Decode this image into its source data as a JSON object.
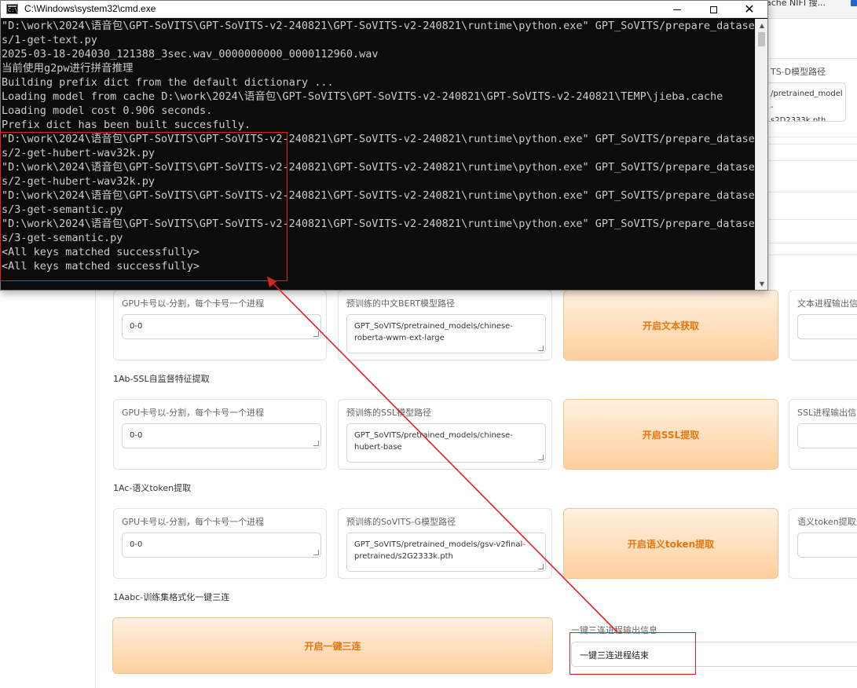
{
  "browser": {
    "tab_text": "ache NIFI 搜..."
  },
  "top_right_panel": {
    "label": "TS-D模型路径",
    "value": "/pretrained_model\n-\ns2D2333k.pth"
  },
  "sections": {
    "ssl_title": "1Ab-SSL自监督特征提取",
    "token_title": "1Ac-语义token提取",
    "abc_title": "1Aabc-训练集格式化一键三连"
  },
  "text_row": {
    "gpu_label": "GPU卡号以-分割，每个卡号一个进程",
    "gpu_value": "0-0",
    "model_label": "预训练的中文BERT模型路径",
    "model_value": "GPT_SoVITS/pretrained_models/chinese-roberta-wwm-ext-large",
    "button": "开启文本获取",
    "out_label": "文本进程输出信"
  },
  "ssl_row": {
    "gpu_label": "GPU卡号以-分割，每个卡号一个进程",
    "gpu_value": "0-0",
    "model_label": "预训练的SSL模型路径",
    "model_value": "GPT_SoVITS/pretrained_models/chinese-hubert-base",
    "button": "开启SSL提取",
    "out_label": "SSL进程输出信息"
  },
  "token_row": {
    "gpu_label": "GPU卡号以-分割，每个卡号一个进程",
    "gpu_value": "0-0",
    "model_label": "预训练的SoVITS-G模型路径",
    "model_value": "GPT_SoVITS/pretrained_models/gsv-v2final-pretrained/s2G2333k.pth",
    "button": "开启语义token提取",
    "out_label": "语义token提取进"
  },
  "abc_row": {
    "button": "开启一键三连",
    "out_label": "一键三连进程输出信息",
    "out_value": "一键三连进程结束"
  },
  "cmd": {
    "title": "C:\\Windows\\system32\\cmd.exe",
    "icon_text": "C:\\",
    "lines": [
      "\"D:\\work\\2024\\语音包\\GPT-SoVITS\\GPT-SoVITS-v2-240821\\GPT-SoVITS-v2-240821\\runtime\\python.exe\" GPT_SoVITS/prepare_dataset",
      "s/1-get-text.py",
      "2025-03-18-204030_121388_3sec.wav_0000000000_0000112960.wav",
      "当前使用g2pw进行拼音推理",
      "Building prefix dict from the default dictionary ...",
      "Loading model from cache D:\\work\\2024\\语音包\\GPT-SoVITS\\GPT-SoVITS-v2-240821\\GPT-SoVITS-v2-240821\\TEMP\\jieba.cache",
      "Loading model cost 0.906 seconds.",
      "Prefix dict has been built succesfully.",
      "\"D:\\work\\2024\\语音包\\GPT-SoVITS\\GPT-SoVITS-v2-240821\\GPT-SoVITS-v2-240821\\runtime\\python.exe\" GPT_SoVITS/prepare_dataset",
      "s/2-get-hubert-wav32k.py",
      "\"D:\\work\\2024\\语音包\\GPT-SoVITS\\GPT-SoVITS-v2-240821\\GPT-SoVITS-v2-240821\\runtime\\python.exe\" GPT_SoVITS/prepare_dataset",
      "s/2-get-hubert-wav32k.py",
      "\"D:\\work\\2024\\语音包\\GPT-SoVITS\\GPT-SoVITS-v2-240821\\GPT-SoVITS-v2-240821\\runtime\\python.exe\" GPT_SoVITS/prepare_dataset",
      "s/3-get-semantic.py",
      "\"D:\\work\\2024\\语音包\\GPT-SoVITS\\GPT-SoVITS-v2-240821\\GPT-SoVITS-v2-240821\\runtime\\python.exe\" GPT_SoVITS/prepare_dataset",
      "s/3-get-semantic.py",
      "<All keys matched successfully>",
      "<All keys matched successfully>"
    ]
  },
  "icons": {
    "minimize": "minimize-icon",
    "maximize": "maximize-icon",
    "close": "close-icon",
    "close_glyph": "✕",
    "scroll_up_glyph": "▲",
    "scroll_down_glyph": "▼"
  },
  "colors": {
    "accent_orange": "#e8750e",
    "annotation_red": "#e02020",
    "console_bg": "#0c0c0c",
    "console_text": "#cccccc"
  }
}
